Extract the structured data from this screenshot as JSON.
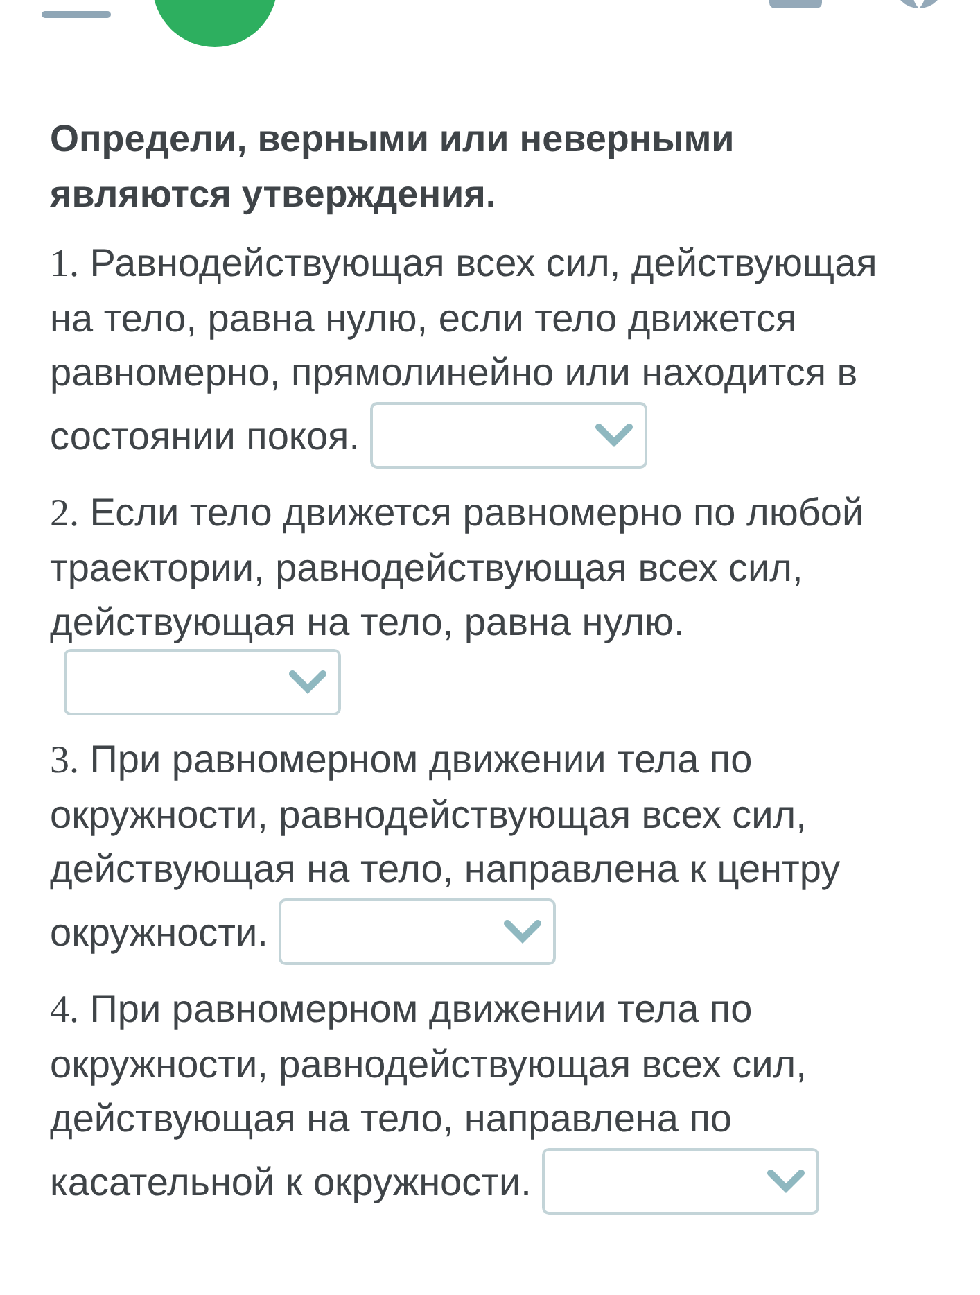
{
  "title": "Определи, верными или неверными являются утверждения.",
  "statements": [
    {
      "number": "1.",
      "lines": [
        "Равнодействующая всех сил, действующая",
        "на тело, равна нулю, если тело движется",
        "равномерно, прямолинейно или находится в",
        "состоянии покоя."
      ]
    },
    {
      "number": "2.",
      "lines": [
        "Если тело движется равномерно по любой",
        "траектории, равнодействующая всех сил,",
        "действующая на тело, равна нулю."
      ]
    },
    {
      "number": "3.",
      "lines": [
        "При равномерном движении тела по",
        "окружности, равнодействующая всех сил,",
        "действующая на тело, направлена к центру",
        "окружности."
      ]
    },
    {
      "number": "4.",
      "lines": [
        "При равномерном движении тела по",
        "окружности, равнодействующая всех сил,",
        "действующая на тело, направлена по",
        "касательной к окружности."
      ]
    }
  ]
}
